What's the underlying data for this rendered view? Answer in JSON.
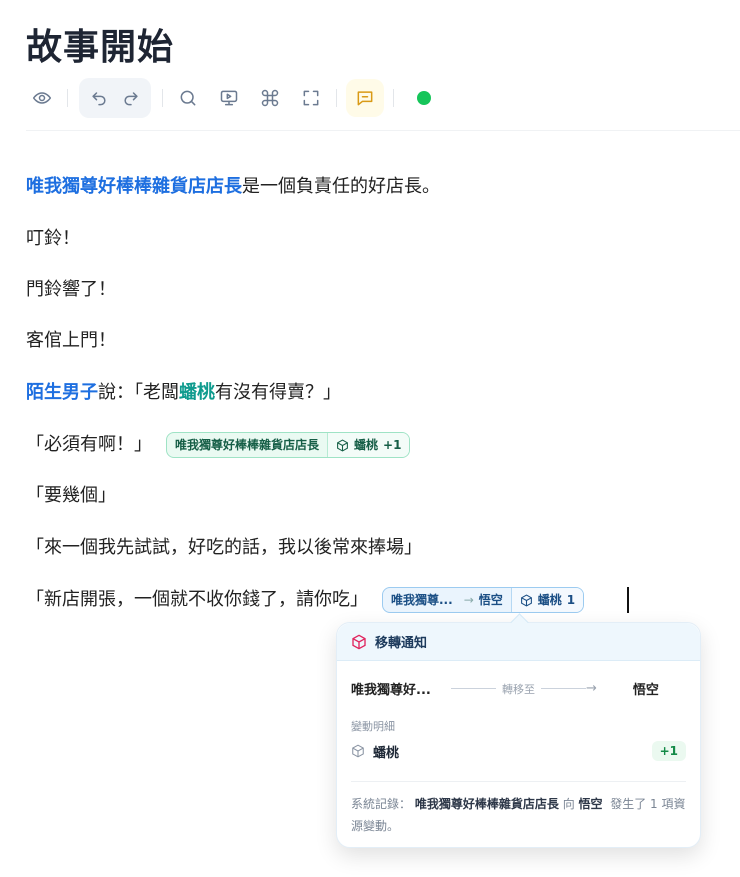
{
  "title": "故事開始",
  "toolbar": {
    "icons": [
      "eye-icon",
      "undo-icon",
      "redo-icon",
      "search-icon",
      "presentation-icon",
      "command-icon",
      "fullscreen-icon",
      "comment-icon",
      "status-dot"
    ],
    "status_color": "#16c55a"
  },
  "paragraphs": {
    "p1": {
      "entity": "唯我獨尊好棒棒雜貨店店長",
      "rest": "是一個負責任的好店長。"
    },
    "p2": "叮鈴！",
    "p3": "門鈴響了！",
    "p4": "客倌上門！",
    "p5": {
      "entity": "陌生男子",
      "t1": "說：「老闆",
      "item": "蟠桃",
      "t2": "有沒有得賣？」"
    },
    "p6": {
      "text": "「必須有啊！」",
      "chip_owner": "唯我獨尊好棒棒雜貨店店長",
      "chip_item": "蟠桃",
      "chip_delta": "+1"
    },
    "p7": "「要幾個」",
    "p8": "「來一個我先試試，好吃的話，我以後常來捧場」",
    "p9": {
      "text": "「新店開張，一個就不收你錢了，請你吃」",
      "chip_from": "唯我獨尊...",
      "chip_arrow": "→",
      "chip_to": "悟空",
      "chip_item": "蟠桃",
      "chip_qty": "1"
    }
  },
  "popover": {
    "title": "移轉通知",
    "from": "唯我獨尊好...",
    "via": "轉移至",
    "to": "悟空",
    "detail_label": "變動明細",
    "item": "蟠桃",
    "delta": "+1",
    "log_prefix": "系統記錄：",
    "log_from": "唯我獨尊好棒棒雜貨店店長",
    "log_mid": "向",
    "log_to": "悟空",
    "log_suffix": "發生了 1 項資源變動。"
  }
}
